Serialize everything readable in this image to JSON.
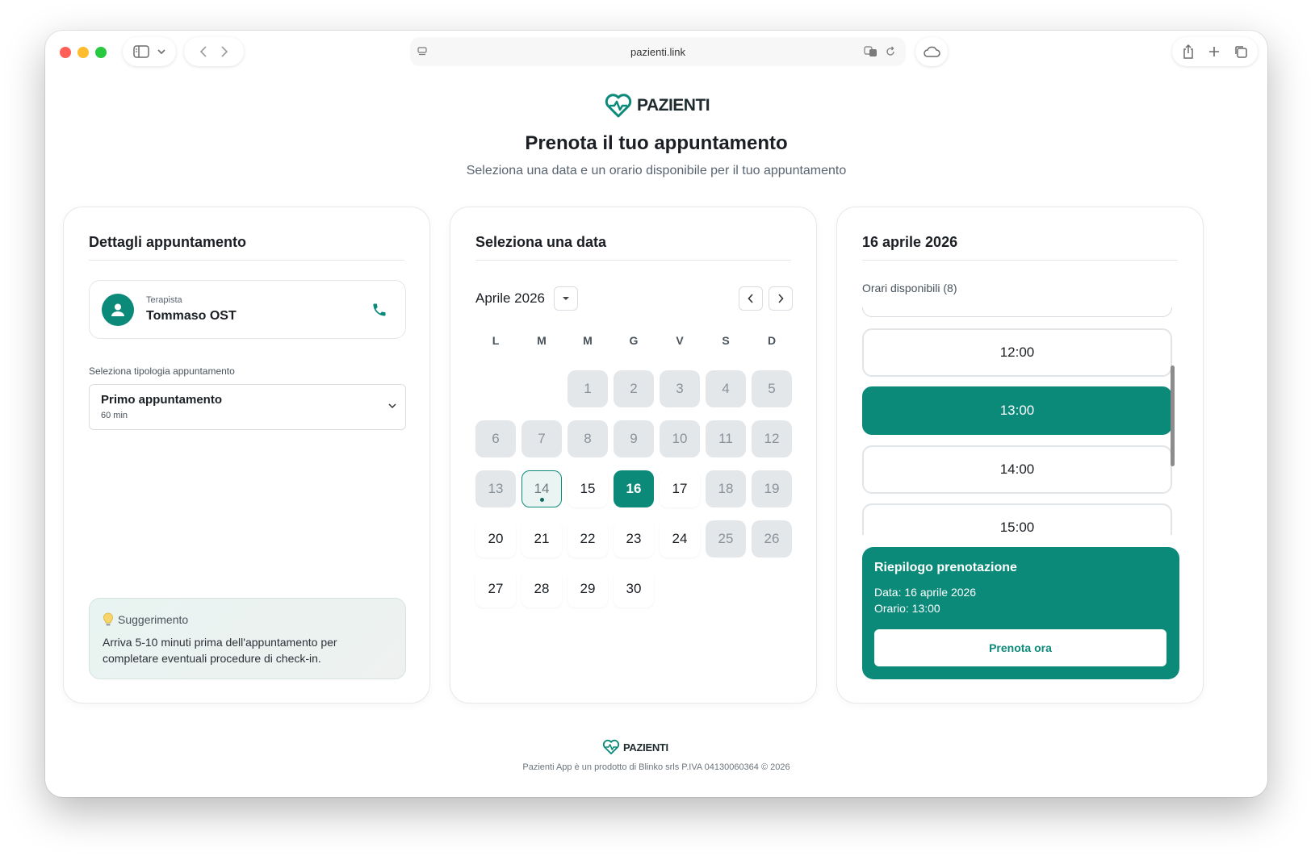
{
  "browser": {
    "url": "pazienti.link"
  },
  "brand": {
    "name": "PAZIENTI",
    "color": "#0b8a7a"
  },
  "page": {
    "title": "Prenota il tuo appuntamento",
    "subtitle": "Seleziona una data e un orario disponibile per il tuo appuntamento"
  },
  "details": {
    "title": "Dettagli appuntamento",
    "therapist_label": "Terapista",
    "therapist_name": "Tommaso OST",
    "select_label": "Seleziona tipologia appuntamento",
    "select_value": "Primo appuntamento",
    "select_sub": "60 min",
    "tip_title": "Suggerimento",
    "tip_text": "Arriva 5-10 minuti prima dell'appuntamento per completare eventuali procedure di check-in."
  },
  "calendar": {
    "title": "Seleziona una data",
    "month": "Aprile 2026",
    "weekdays": [
      "L",
      "M",
      "M",
      "G",
      "V",
      "S",
      "D"
    ],
    "days": [
      {
        "label": "1",
        "state": "disabled"
      },
      {
        "label": "2",
        "state": "disabled"
      },
      {
        "label": "3",
        "state": "disabled"
      },
      {
        "label": "4",
        "state": "disabled"
      },
      {
        "label": "5",
        "state": "disabled"
      },
      {
        "label": "6",
        "state": "disabled"
      },
      {
        "label": "7",
        "state": "disabled"
      },
      {
        "label": "8",
        "state": "disabled"
      },
      {
        "label": "9",
        "state": "disabled"
      },
      {
        "label": "10",
        "state": "disabled"
      },
      {
        "label": "11",
        "state": "disabled"
      },
      {
        "label": "12",
        "state": "disabled"
      },
      {
        "label": "13",
        "state": "disabled"
      },
      {
        "label": "14",
        "state": "today"
      },
      {
        "label": "15",
        "state": "available"
      },
      {
        "label": "16",
        "state": "selected"
      },
      {
        "label": "17",
        "state": "available"
      },
      {
        "label": "18",
        "state": "disabled"
      },
      {
        "label": "19",
        "state": "disabled"
      },
      {
        "label": "20",
        "state": "available"
      },
      {
        "label": "21",
        "state": "available"
      },
      {
        "label": "22",
        "state": "available"
      },
      {
        "label": "23",
        "state": "available"
      },
      {
        "label": "24",
        "state": "available"
      },
      {
        "label": "25",
        "state": "disabled"
      },
      {
        "label": "26",
        "state": "disabled"
      },
      {
        "label": "27",
        "state": "available"
      },
      {
        "label": "28",
        "state": "available"
      },
      {
        "label": "29",
        "state": "available"
      },
      {
        "label": "30",
        "state": "available"
      }
    ]
  },
  "slots": {
    "title": "16 aprile 2026",
    "available_label": "Orari disponibili (8)",
    "times": [
      "12:00",
      "13:00",
      "14:00",
      "15:00"
    ],
    "selected_time": "13:00"
  },
  "summary": {
    "title": "Riepilogo prenotazione",
    "date_line": "Data: 16 aprile 2026",
    "time_line": "Orario: 13:00",
    "button": "Prenota ora"
  },
  "footer": {
    "brand": "PAZIENTI",
    "text": "Pazienti App è un prodotto di Blinko srls P.IVA 04130060364 © 2026"
  }
}
